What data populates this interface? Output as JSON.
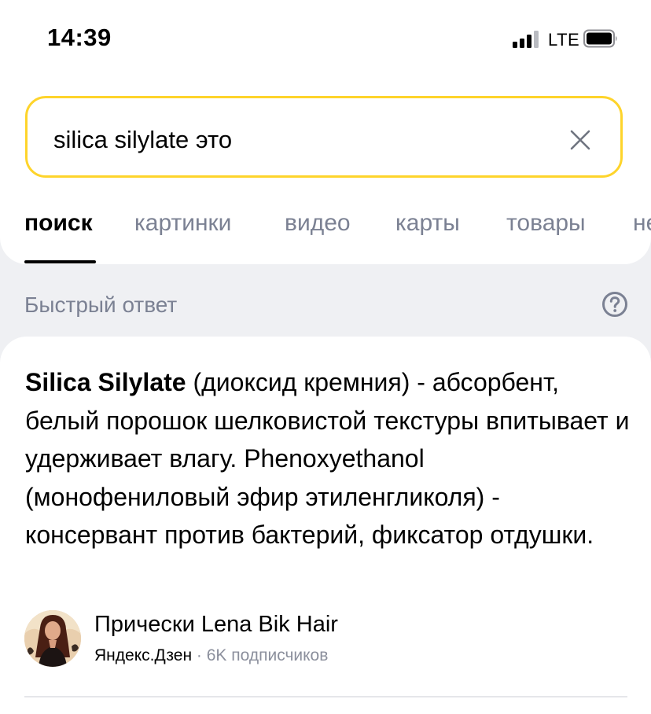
{
  "status_bar": {
    "time": "14:39",
    "network": "LTE"
  },
  "search": {
    "query": "silica silylate это"
  },
  "tabs": [
    {
      "label": "поиск",
      "active": true
    },
    {
      "label": "картинки",
      "active": false
    },
    {
      "label": "видео",
      "active": false
    },
    {
      "label": "карты",
      "active": false
    },
    {
      "label": "товары",
      "active": false
    },
    {
      "label": "не",
      "active": false
    }
  ],
  "quick_answer": {
    "label": "Быстрый ответ",
    "term": "Silica Silylate",
    "body": " (диоксид кремния) - абсорбент, белый порошок шелковистой текстуры впитывает и удерживает влагу. Phenoxyethanol (монофениловый эфир этиленгликоля) - консервант против бактерий, фиксатор отдушки."
  },
  "source": {
    "name": "Прически Lena Bik Hair",
    "platform": "Яндекс.Дзен",
    "separator": "·",
    "subscribers": "6K подписчиков"
  },
  "colors": {
    "accent": "#fed42b",
    "muted": "#7b8193",
    "background": "#eff0f3"
  }
}
